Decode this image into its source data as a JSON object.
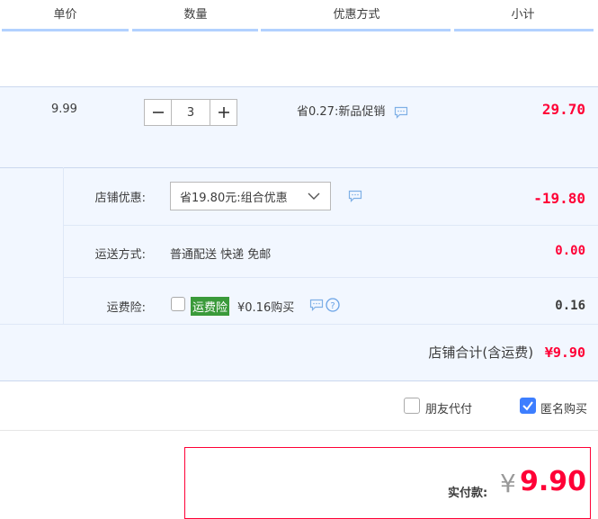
{
  "header": {
    "columns": [
      "单价",
      "数量",
      "优惠方式",
      "小计"
    ]
  },
  "item": {
    "price": "9.99",
    "quantity": "3",
    "promo": "省0.27:新品促销",
    "subtotal": "29.70"
  },
  "shop": {
    "discount_label": "店铺优惠:",
    "discount_selected": "省19.80元:组合优惠",
    "discount_value": "-19.80",
    "shipping_label": "运送方式:",
    "shipping_text": "普通配送 快递 免邮",
    "shipping_value": "0.00",
    "insurance_label": "运费险:",
    "insurance_badge": "运费险",
    "insurance_text": "¥0.16购买",
    "insurance_value": "0.16",
    "total_label": "店铺合计(含运费)",
    "total_value": "¥9.90"
  },
  "options": {
    "friend_pay_label": "朋友代付",
    "friend_pay_checked": false,
    "anonymous_label": "匿名购买",
    "anonymous_checked": true
  },
  "payment": {
    "label": "实付款:",
    "currency": "¥",
    "amount": "9.90"
  },
  "colors": {
    "accent_red": "#ff0036",
    "header_line": "#b2d1ff",
    "section_bg": "#f2f7ff",
    "checkbox_blue": "#3d7eff",
    "badge_green": "#3a9a3a"
  },
  "icons": [
    "minus-icon",
    "plus-icon",
    "message-icon",
    "chevron-down-icon",
    "help-icon",
    "check-icon"
  ]
}
